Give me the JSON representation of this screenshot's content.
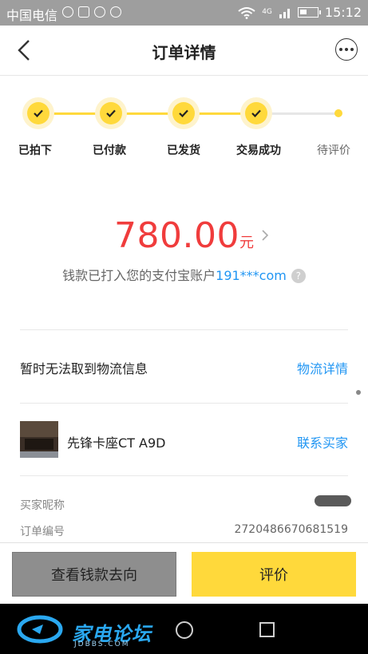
{
  "status_bar": {
    "carrier": "中国电信",
    "network": "4G",
    "time": "15:12"
  },
  "header": {
    "title": "订单详情"
  },
  "progress": {
    "steps": [
      {
        "label": "已拍下",
        "done": true
      },
      {
        "label": "已付款",
        "done": true
      },
      {
        "label": "已发货",
        "done": true
      },
      {
        "label": "交易成功",
        "done": true
      },
      {
        "label": "待评价",
        "done": false
      }
    ],
    "accent_color": "#ffd93b"
  },
  "payment": {
    "amount": "780.00",
    "unit": "元",
    "note_prefix": "钱款已打入您的支付宝账户",
    "account": "191***com",
    "help_glyph": "?"
  },
  "logistics": {
    "text": "暂时无法取到物流信息",
    "link": "物流详情"
  },
  "product": {
    "name": "先锋卡座CT A9D",
    "contact": "联系买家"
  },
  "info": {
    "buyer_label": "买家昵称",
    "order_label": "订单编号",
    "order_number": "2720486670681519"
  },
  "actions": {
    "check_funds": "查看钱款去向",
    "rate": "评价"
  },
  "watermark": {
    "text": "家电论坛",
    "sub": "JDBBS.COM"
  }
}
